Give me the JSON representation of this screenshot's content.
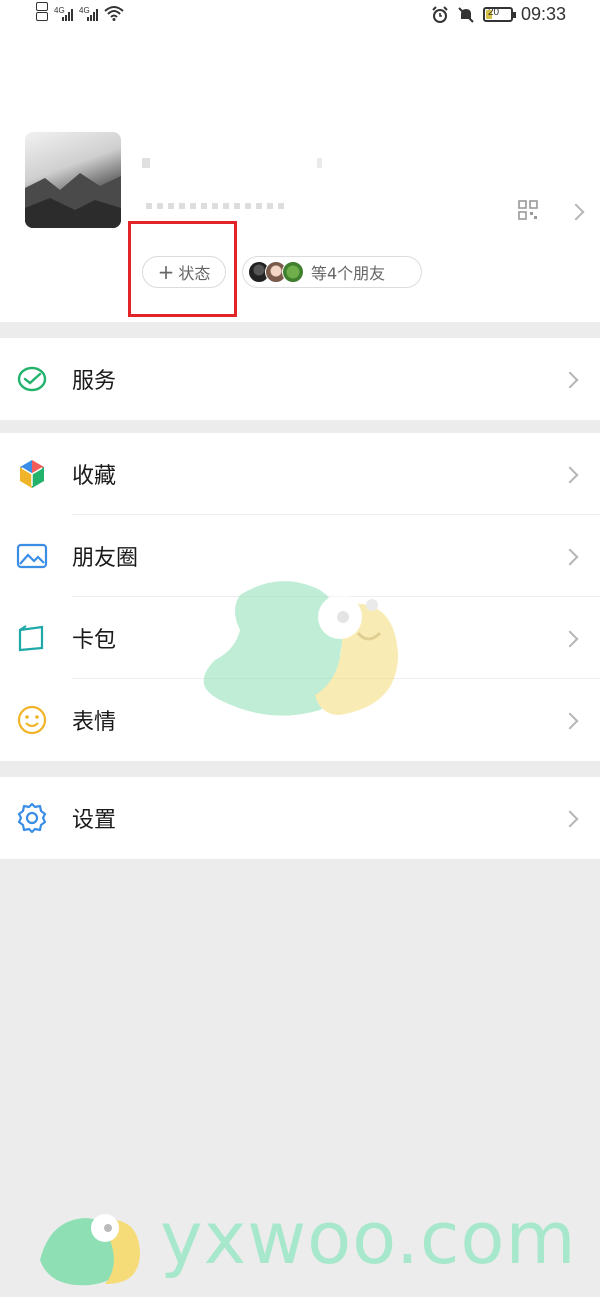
{
  "status_bar": {
    "time": "09:33",
    "signal_label": "4G",
    "signal_label_2": "4G",
    "battery_text": "20",
    "battery_level": 0.2,
    "icons": [
      "sim-icon",
      "signal-icon",
      "signal-icon",
      "wifi-icon",
      "alarm-icon",
      "mute-icon",
      "battery-icon"
    ]
  },
  "profile": {
    "status_button_label": "状态",
    "status_button_icon": "plus-icon",
    "friends_label": "等4个朋友",
    "qr_icon": "qr-code-icon",
    "highlight_color": "#e2232a"
  },
  "menu": {
    "services": {
      "label": "服务",
      "icon": "wechat-pay-icon",
      "color": "#22b26b"
    },
    "favorites": {
      "label": "收藏",
      "icon": "cube-icon"
    },
    "moments": {
      "label": "朋友圈",
      "icon": "photo-icon",
      "color": "#3a8ee6"
    },
    "cards": {
      "label": "卡包",
      "icon": "wallet-icon",
      "color": "#1fa8a8"
    },
    "stickers": {
      "label": "表情",
      "icon": "smiley-icon",
      "color": "#f0b429"
    },
    "settings": {
      "label": "设置",
      "icon": "gear-icon",
      "color": "#3a8ee6"
    }
  },
  "watermark": {
    "text": "yxwoo.com"
  }
}
